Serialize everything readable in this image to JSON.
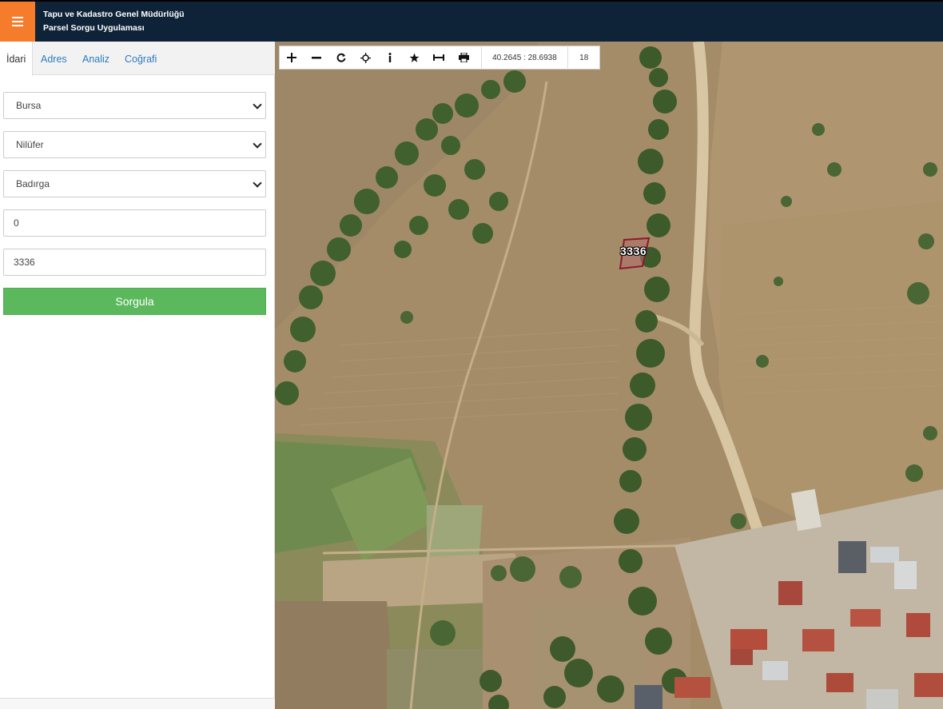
{
  "header": {
    "menu_icon": "hamburger-icon",
    "title_line1": "Tapu ve Kadastro Genel Müdürlüğü",
    "title_line2": "Parsel Sorgu Uygulaması",
    "accent": "#f57c2b",
    "background": "#0f2338"
  },
  "tabs": [
    {
      "label": "İdari",
      "active": true
    },
    {
      "label": "Adres",
      "active": false
    },
    {
      "label": "Analiz",
      "active": false
    },
    {
      "label": "Coğrafi",
      "active": false
    }
  ],
  "form": {
    "province": "Bursa",
    "district": "Nilüfer",
    "neighborhood": "Badırga",
    "block": "0",
    "parcel": "3336",
    "submit_label": "Sorgula",
    "submit_color": "#5cb85c"
  },
  "toolbar": {
    "tools": [
      "plus-icon",
      "minus-icon",
      "refresh-icon",
      "locate-icon",
      "info-icon",
      "star-icon",
      "measure-icon",
      "print-icon"
    ],
    "coordinates": "40.2645 : 28.6938",
    "zoom": "18"
  },
  "map": {
    "parcel_label": "3336",
    "parcel_color": "#8b1a2a"
  }
}
